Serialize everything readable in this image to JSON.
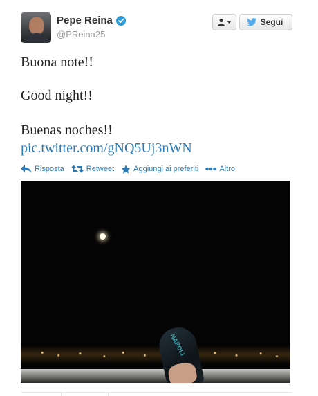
{
  "author": {
    "fullname": "Pepe Reina",
    "username": "@PReina25",
    "verified": true
  },
  "buttons": {
    "user_menu_icon": "user-dropdown-icon",
    "follow_label": "Segui"
  },
  "tweet": {
    "lines": [
      "Buona note!!",
      "Good night!!",
      "Buenas noches!!"
    ],
    "link": "pic.twitter.com/gNQ5Uj3nWN"
  },
  "actions": [
    {
      "label": "Risposta",
      "icon": "reply-icon"
    },
    {
      "label": "Retweet",
      "icon": "retweet-icon"
    },
    {
      "label": "Aggiungi ai preferiti",
      "icon": "star-icon"
    },
    {
      "label": "Altro",
      "icon": "more-icon"
    }
  ],
  "photo": {
    "slipper_text": "NAPOLI"
  },
  "colors": {
    "link": "#2b7bb9",
    "verified": "#2b9bdb",
    "follow_bird": "#55acee"
  }
}
